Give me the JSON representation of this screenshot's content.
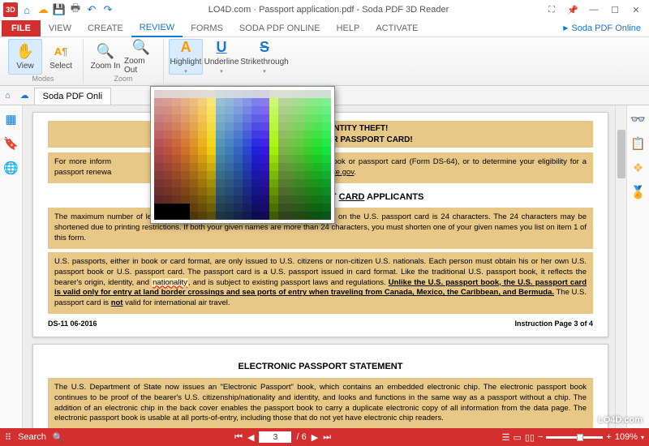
{
  "titlebar": {
    "title": "LO4D.com · Passport application.pdf    -    Soda PDF 3D Reader"
  },
  "tabs": {
    "file": "FILE",
    "items": [
      "VIEW",
      "CREATE",
      "REVIEW",
      "FORMS",
      "SODA PDF ONLINE",
      "HELP",
      "ACTIVATE"
    ],
    "active": "REVIEW",
    "online": "Soda PDF Online"
  },
  "ribbon": {
    "groups": [
      {
        "label": "Modes",
        "buttons": [
          {
            "label": "View",
            "icon": "✋"
          },
          {
            "label": "Select",
            "icon": "A¶"
          }
        ]
      },
      {
        "label": "Zoom",
        "buttons": [
          {
            "label": "Zoom In",
            "icon": "🔍"
          },
          {
            "label": "Zoom Out",
            "icon": "🔍"
          }
        ]
      },
      {
        "label": "",
        "buttons": [
          {
            "label": "Highlight",
            "icon": "A",
            "sel": true
          },
          {
            "label": "Underline",
            "icon": "U"
          },
          {
            "label": "Strikethrough",
            "icon": "S"
          }
        ]
      }
    ]
  },
  "doctab": {
    "label": "Soda PDF Onli"
  },
  "document": {
    "banner1": "RSELF AGAINST IDENTITY THEFT!",
    "banner2": "OLEN PASSPORT BOOK OR PASSPORT CARD!",
    "info_prefix": "For more inform",
    "info_suffix": "passport book or passport card (Form DS-64), or to determine your eligibility for a passport renewa",
    "info_link": "travel.state.gov",
    "info_visit": "or visit ",
    "section1": "NOTICE TO U.S. PASSPORT ",
    "section1_u": "CARD",
    "section1_end": " APPLICANTS",
    "para1": "The maximum number of letters provided for your given name (first and middle) on the U.S. passport card is 24 characters.  The 24 characters may be shortened due to printing restrictions.  If both your given names are more than 24 characters, you must shorten one of your given names you list on item 1 of this form.",
    "para2a": "U.S. passports, either in book or card format, are only issued to U.S. citizens or non-citizen U.S. nationals. Each person must obtain his or her own U.S. passport book or U.S. passport card. ",
    "para2b": "The passport card is a U.S. passport issued in card format. Like the traditional U.S. passport book, it reflects the bearer's origin, identity, and ",
    "hlword": "nationality",
    "para2c": ", and is subject to existing passport laws and regulations. ",
    "para2_u": "Unlike the U.S. passport book, the U.S. passport card is valid only for entry at land border crossings and sea ports of entry when traveling from Canada, Mexico, the Caribbean, and Bermuda.",
    "para2d": " The U.S. passport card is ",
    "para2_not": "not",
    "para2e": " valid for international air travel.",
    "footer_l": "DS-11   06-2016",
    "footer_r": "Instruction Page 3 of 4",
    "section2": "ELECTRONIC PASSPORT STATEMENT",
    "para3": "The U.S. Department of State now issues an \"Electronic Passport\" book, which contains an embedded electronic chip.  The electronic passport book continues to be proof of the bearer's U.S. citizenship/nationality  and identity, and looks and functions in the same way as a passport without a chip.  The addition of an electronic chip in the back cover enables the passport book to carry a duplicate electronic copy of all information from the data page.  The electronic passport book is usable at all ports-of-entry, including those that do not yet have electronic chip readers."
  },
  "status": {
    "search": "Search",
    "page_current": "3",
    "page_total": "/ 6",
    "zoom": "109%"
  },
  "watermark": "LO4D.com"
}
